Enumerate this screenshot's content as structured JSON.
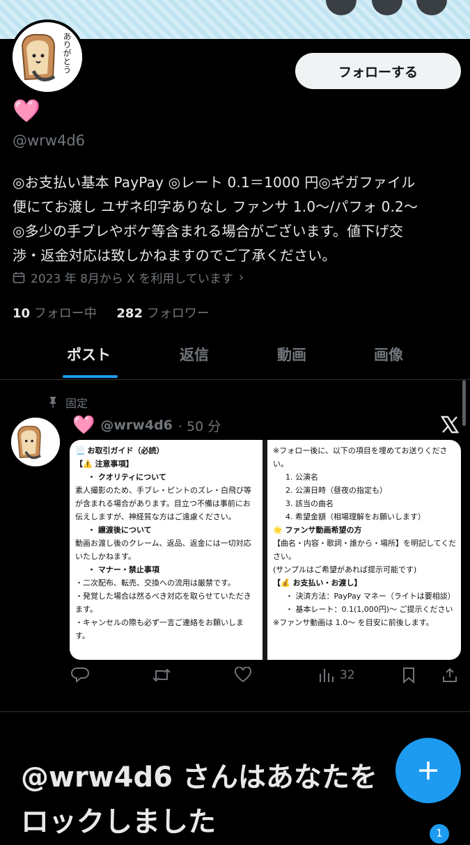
{
  "profile": {
    "follow_label": "フォローする",
    "display_name_emoji": "🩷",
    "handle": "@wrw4d6",
    "bio_lines": [
      "◎お支払い基本 PayPay ◎レート 0.1＝1000 円◎ギガファイル",
      "便にてお渡し ユザネ印字ありなし ファンサ 1.0〜/パフォ 0.2〜",
      "◎多少の手ブレやボケ等含まれる場合がございます。値下げ交",
      "渉・返金対応は致しかねますのでご了承ください。"
    ],
    "joined": "2023 年 8月から X を利用しています",
    "following_count": "10",
    "following_label": "フォロー中",
    "followers_count": "282",
    "followers_label": "フォロワー",
    "avatar_text": "ありがとう"
  },
  "tabs": [
    "ポスト",
    "返信",
    "動画",
    "画像"
  ],
  "post": {
    "pinned_label": "固定",
    "emoji": "🩷",
    "handle": "@wrw4d6",
    "time": "· 50 分",
    "views": "32",
    "left_panel": [
      "📃 お取引ガイド（必読）",
      "【⚠️ 注意事項】",
      "・ クオリティについて",
      "素人撮影のため、手ブレ・ピントのズレ・白飛び等",
      "が含まれる場合があります。目立つ不備は事前にお",
      "伝えしますが、神経質な方はご遠慮ください。",
      "・ 譲渡後について",
      "動画お渡し後のクレーム、返品、返金には一切対応",
      "いたしかねます。",
      "・ マナー・禁止事項",
      "・二次配布、転売、交換への流用は厳禁です。",
      "・発覚した場合は然るべき対応を取らせていただき",
      "ます。",
      "・キャンセルの際も必ず一言ご連絡をお願いしま",
      "す。"
    ],
    "right_panel": [
      "※フォロー後に、以下の項目を埋めてお送りくださ",
      "い。",
      "1.  公演名",
      "2.  公演日時（昼夜の指定も）",
      "3.  該当の曲名",
      "4.  希望金額（相場理解をお願いします）",
      "🌟 ファンサ動画希望の方",
      "【曲名・内容・歌詞・誰から・場所】を明記してくだ",
      "さい。",
      "(サンプルはご希望があれば提示可能です)",
      "【💰 お支払い・お渡し】",
      "・ 決済方法：PayPay マネー（ライトは要相談）",
      "・ 基本レート：0.1(1,000円)〜 ご提示ください",
      "※ファンサ動画は 1.0〜 を目安に前後します。"
    ]
  },
  "blocked_notice": {
    "line1": "@wrw4d6 さんはあなたを",
    "line2": "ロックしました"
  },
  "nav": {
    "notification_badge": "1"
  }
}
